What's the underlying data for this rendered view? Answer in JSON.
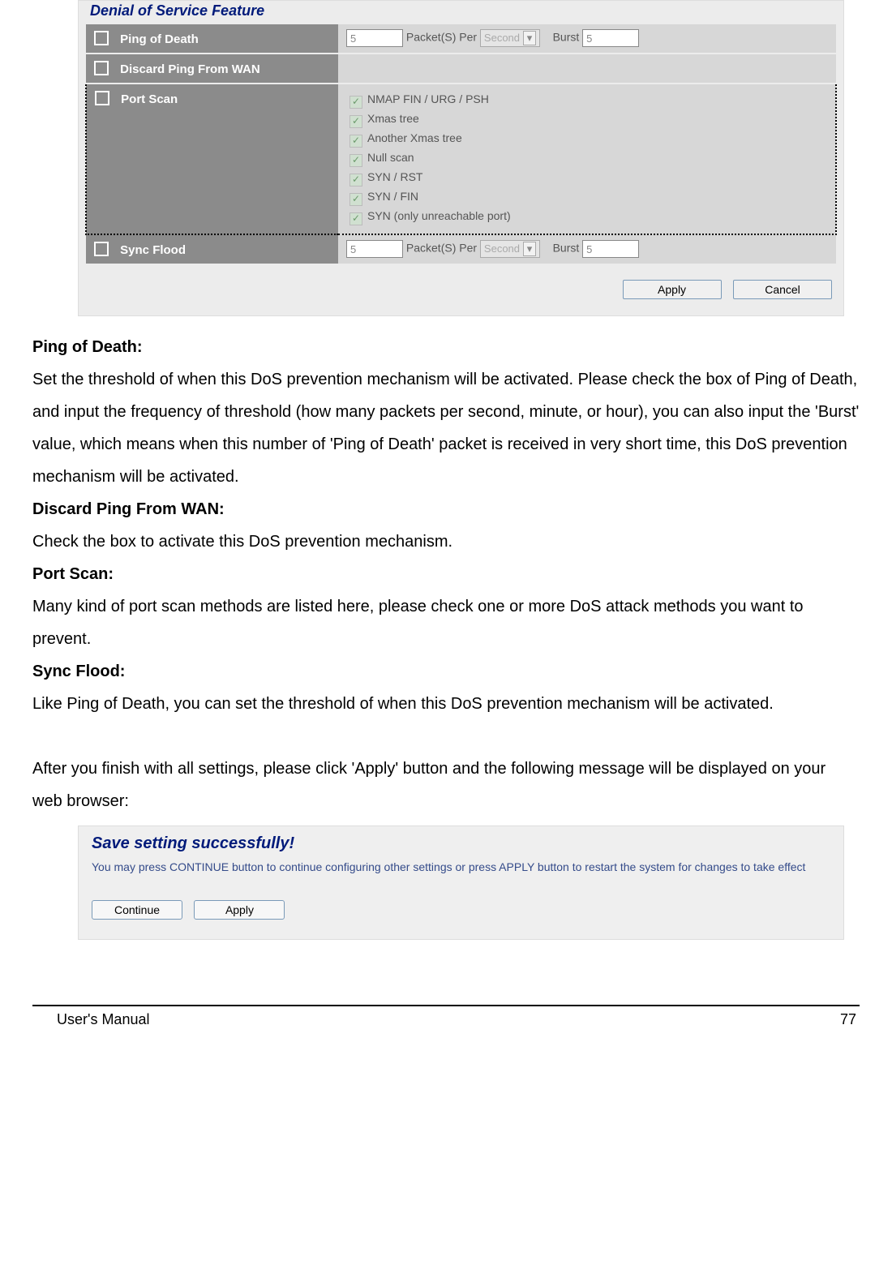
{
  "panel": {
    "section_title": "Denial of Service Feature",
    "rows": {
      "ping_of_death": {
        "label": "Ping of Death",
        "value": "5",
        "text_packets": "Packet(S) Per",
        "select": "Second",
        "text_burst": "Burst",
        "burst_value": "5"
      },
      "discard_ping": {
        "label": "Discard Ping From WAN"
      },
      "port_scan": {
        "label": "Port Scan",
        "options": [
          "NMAP FIN / URG / PSH",
          "Xmas tree",
          "Another Xmas tree",
          "Null scan",
          "SYN / RST",
          "SYN / FIN",
          "SYN (only unreachable port)"
        ]
      },
      "sync_flood": {
        "label": "Sync Flood",
        "value": "5",
        "text_packets": "Packet(S) Per",
        "select": "Second",
        "text_burst": "Burst",
        "burst_value": "5"
      }
    },
    "buttons": {
      "apply": "Apply",
      "cancel": "Cancel"
    }
  },
  "doc": {
    "h1": "Ping of Death:",
    "p1": "Set the threshold of when this DoS prevention mechanism will be activated. Please check the box of Ping of Death, and input the frequency of threshold (how many packets per second, minute, or hour), you can also input the 'Burst' value, which means when this number of 'Ping of Death' packet is received in very short time, this DoS prevention mechanism will be activated.",
    "h2": "Discard Ping From WAN:",
    "p2": "Check the box to activate this DoS prevention mechanism.",
    "h3": "Port Scan:",
    "p3": "Many kind of port scan methods are listed here, please check one or more DoS attack methods you want to prevent.",
    "h4": "Sync Flood:",
    "p4": "Like Ping of Death, you can set the threshold of when this DoS prevention mechanism will be activated.",
    "p5": "After you finish with all settings, please click 'Apply' button and the following message will be displayed on your web browser:"
  },
  "panel2": {
    "title": "Save setting successfully!",
    "msg": "You may press CONTINUE button to continue configuring other settings or press APPLY button to restart the system for changes to take effect",
    "continue": "Continue",
    "apply": "Apply"
  },
  "footer": {
    "left": "User's Manual",
    "right": "77"
  }
}
